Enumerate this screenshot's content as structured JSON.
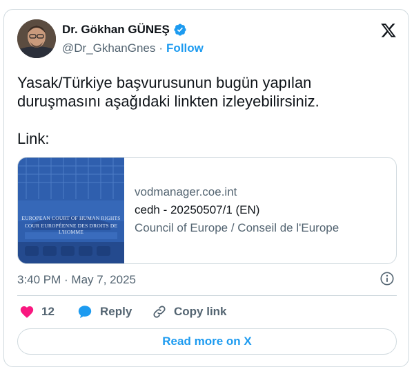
{
  "author": {
    "name": "Dr. Gökhan GÜNEŞ",
    "handle": "@Dr_GkhanGnes",
    "separator": "·",
    "follow_label": "Follow"
  },
  "tweet": {
    "text": "Yasak/Türkiye başvurusunun bugün yapılan\nduruşmasını aşağıdaki linkten izleyebilirsiniz.\n\nLink:"
  },
  "link_card": {
    "domain": "vodmanager.coe.int",
    "title": "cedh - 20250507/1 (EN)",
    "description": "Council of Europe / Conseil de l'Europe",
    "thumb_line1": "EUROPEAN COURT OF HUMAN RIGHTS",
    "thumb_line2": "COUR EUROPÉENNE DES DROITS DE L'HOMME"
  },
  "meta": {
    "timestamp": "3:40 PM · May 7, 2025"
  },
  "actions": {
    "like_count": "12",
    "reply_label": "Reply",
    "copy_label": "Copy link"
  },
  "read_more_label": "Read more on X",
  "colors": {
    "accent": "#1d9bf0",
    "like": "#f91880",
    "text": "#0f1419",
    "secondary": "#536471",
    "border": "#cfd9de"
  }
}
